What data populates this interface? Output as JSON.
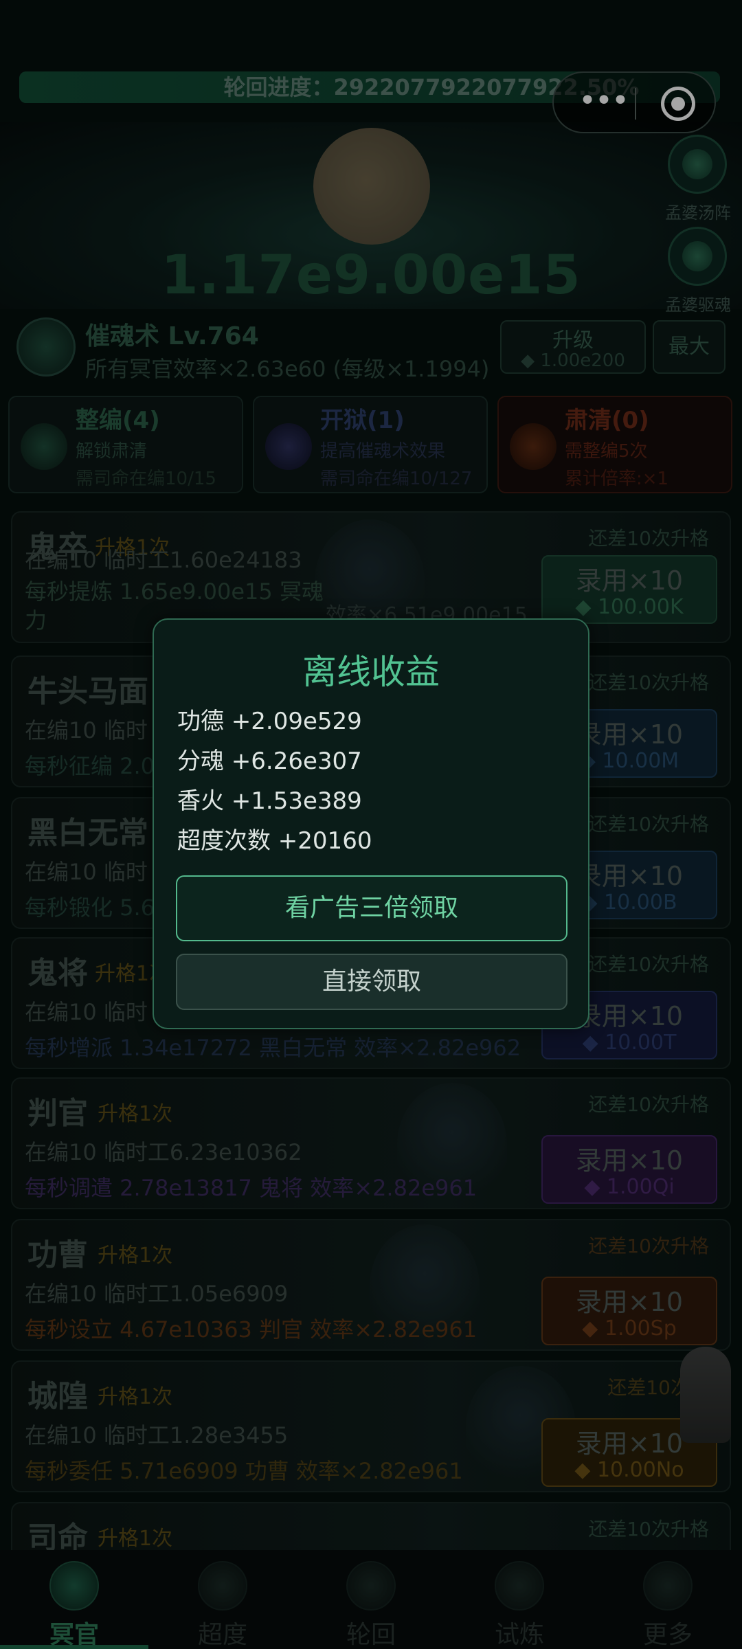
{
  "top": {
    "progress_label": "轮回进度：2922077922077922.50%",
    "big_value": "1.17e9.00e15"
  },
  "side_buttons": [
    {
      "label": "孟婆汤阵",
      "icon": "soup-icon"
    },
    {
      "label": "孟婆驱魂",
      "icon": "spirit-icon"
    }
  ],
  "skill": {
    "title": "催魂术 Lv.764",
    "desc": "所有冥官效率×2.63e60 (每级×1.1994)",
    "upgrade_label": "升级",
    "upgrade_cost": "◆ 1.00e200",
    "max_label": "最大"
  },
  "mid_cards": [
    {
      "title": "整编(4)",
      "line1": "解锁肃清",
      "line2": "需司命在编10/15",
      "color": "#2b6a52"
    },
    {
      "title": "开狱(1)",
      "line1": "提高催魂术效果",
      "line2": "需司命在编10/127",
      "color": "#2d3f6e"
    },
    {
      "title": "肃清(0)",
      "line1": "需整编5次",
      "line2": "累计倍率:×1",
      "color": "#7a2e1c"
    }
  ],
  "staff": [
    {
      "name": "鬼卒",
      "tag": "升格1次",
      "count": "在编10  临时工1.60e24183",
      "rate": "每秒提炼 1.65e9.00e15 冥魂力",
      "eff": "效率×6.51e9.00e15",
      "remain": "还差10次升格",
      "buy": "录用×10",
      "cost": "◆ 100.00K",
      "color": "#2e5f48"
    },
    {
      "name": "牛头马面",
      "tag": "",
      "count": "在编10  临时",
      "rate": "每秒征编 2.0",
      "eff": "",
      "remain": "还差10次升格",
      "buy": "录用×10",
      "cost": "◆ 10.00M",
      "color": "#2a4a6a"
    },
    {
      "name": "黑白无常",
      "tag": "",
      "count": "在编10  临时",
      "rate": "每秒锻化 5.6",
      "eff": "",
      "remain": "还差10次升格",
      "buy": "录用×10",
      "cost": "◆ 10.00B",
      "color": "#2a4a6a"
    },
    {
      "name": "鬼将",
      "tag": "升格1次",
      "count": "在编10  临时",
      "rate": "每秒增派 1.34e17272 黑白无常  效率×2.82e962",
      "eff": "",
      "remain": "还差10次升格",
      "buy": "录用×10",
      "cost": "◆ 10.00T",
      "color": "#2f3f6a"
    },
    {
      "name": "判官",
      "tag": "升格1次",
      "count": "在编10  临时工6.23e10362",
      "rate": "每秒调遣 2.78e13817 鬼将  效率×2.82e961",
      "eff": "",
      "remain": "还差10次升格",
      "buy": "录用×10",
      "cost": "◆ 1.00Qi",
      "color": "#4a2a6a"
    },
    {
      "name": "功曹",
      "tag": "升格1次",
      "count": "在编10  临时工1.05e6909",
      "rate": "每秒设立 4.67e10363 判官  效率×2.82e961",
      "eff": "",
      "remain": "还差10次升格",
      "buy": "录用×10",
      "cost": "◆ 1.00Sp",
      "color": "#6a3a1a"
    },
    {
      "name": "城隍",
      "tag": "升格1次",
      "count": "在编10  临时工1.28e3455",
      "rate": "每秒委任 5.71e6909 功曹  效率×2.82e961",
      "eff": "",
      "remain": "还差10次升",
      "buy": "录用×10",
      "cost": "◆ 10.00No",
      "color": "#6a4a14"
    },
    {
      "name": "司命",
      "tag": "升格1次",
      "count": "",
      "rate": "",
      "eff": "",
      "remain": "还差10次升格",
      "buy": "",
      "cost": "",
      "color": "#2e5f48"
    }
  ],
  "nav": [
    "冥官",
    "超度",
    "轮回",
    "试炼",
    "更多"
  ],
  "modal": {
    "title": "离线收益",
    "rows": [
      "功德 +2.09e529",
      "分魂 +6.26e307",
      "香火 +1.53e389",
      "超度次数 +20160"
    ],
    "ad_button": "看广告三倍领取",
    "claim_button": "直接领取"
  }
}
